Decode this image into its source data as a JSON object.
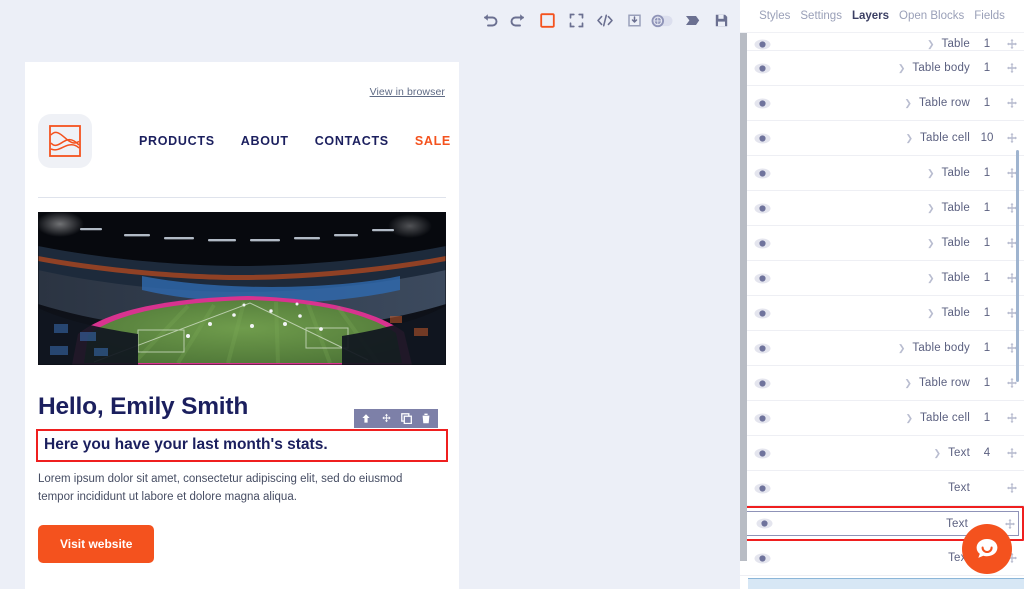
{
  "toolbar": {
    "buttons": [
      {
        "name": "undo-icon",
        "label": "Undo"
      },
      {
        "name": "redo-icon",
        "label": "Redo"
      },
      {
        "name": "border-toggle-icon",
        "label": "Toggle borders"
      },
      {
        "name": "fullscreen-icon",
        "label": "Fullscreen"
      },
      {
        "name": "code-icon",
        "label": "View code"
      },
      {
        "name": "import-icon",
        "label": "Import"
      },
      {
        "name": "preview-toggle-icon",
        "label": "Preview"
      },
      {
        "name": "send-icon",
        "label": "Send test"
      },
      {
        "name": "save-icon",
        "label": "Save"
      }
    ]
  },
  "email": {
    "view_in_browser": "View in browser",
    "logo_alt": "brand-logo",
    "nav": [
      {
        "label": "PRODUCTS",
        "sale": false
      },
      {
        "label": "ABOUT",
        "sale": false
      },
      {
        "label": "CONTACTS",
        "sale": false
      },
      {
        "label": "SALE",
        "sale": true
      }
    ],
    "hero_alt": "stadium-night-photo",
    "greeting": "Hello, Emily Smith",
    "subline": "Here you have your last month's stats.",
    "body": "Lorem ipsum dolor sit amet, consectetur adipiscing elit, sed do eiusmod tempor incididunt ut labore et dolore magna aliqua.",
    "cta_label": "Visit website",
    "element_toolbar": [
      {
        "name": "select-parent-icon",
        "label": "Select parent"
      },
      {
        "name": "move-icon",
        "label": "Move"
      },
      {
        "name": "copy-icon",
        "label": "Duplicate"
      },
      {
        "name": "trash-icon",
        "label": "Delete"
      }
    ]
  },
  "panel": {
    "tabs": [
      {
        "label": "Styles",
        "active": false
      },
      {
        "label": "Settings",
        "active": false
      },
      {
        "label": "Layers",
        "active": true
      },
      {
        "label": "Open Blocks",
        "active": false
      },
      {
        "label": "Fields",
        "active": false
      }
    ],
    "layers": [
      {
        "label": "Table",
        "count": "1",
        "indent": 3,
        "chevron": true,
        "clipped": true,
        "selected": false
      },
      {
        "label": "Table body",
        "count": "1",
        "indent": 3,
        "chevron": true,
        "clipped": false,
        "selected": false
      },
      {
        "label": "Table row",
        "count": "1",
        "indent": 4,
        "chevron": true,
        "clipped": false,
        "selected": false
      },
      {
        "label": "Table cell",
        "count": "10",
        "indent": 5,
        "chevron": true,
        "clipped": false,
        "selected": false
      },
      {
        "label": "Table",
        "count": "1",
        "indent": 6,
        "chevron": true,
        "clipped": false,
        "selected": false
      },
      {
        "label": "Table",
        "count": "1",
        "indent": 6,
        "chevron": true,
        "clipped": false,
        "selected": false
      },
      {
        "label": "Table",
        "count": "1",
        "indent": 6,
        "chevron": true,
        "clipped": false,
        "selected": false
      },
      {
        "label": "Table",
        "count": "1",
        "indent": 6,
        "chevron": true,
        "clipped": false,
        "selected": false
      },
      {
        "label": "Table",
        "count": "1",
        "indent": 6,
        "chevron": true,
        "clipped": false,
        "selected": false
      },
      {
        "label": "Table body",
        "count": "1",
        "indent": 6,
        "chevron": true,
        "clipped": false,
        "selected": false
      },
      {
        "label": "Table row",
        "count": "1",
        "indent": 7,
        "chevron": true,
        "clipped": false,
        "selected": false
      },
      {
        "label": "Table cell",
        "count": "1",
        "indent": 8,
        "chevron": true,
        "clipped": false,
        "selected": false
      },
      {
        "label": "Text",
        "count": "4",
        "indent": 9,
        "chevron": true,
        "clipped": false,
        "selected": false
      },
      {
        "label": "Text",
        "count": "",
        "indent": 9,
        "chevron": false,
        "clipped": false,
        "selected": false
      },
      {
        "label": "Text",
        "count": "",
        "indent": 9,
        "chevron": false,
        "clipped": false,
        "selected": true
      },
      {
        "label": "Text",
        "count": "",
        "indent": 9,
        "chevron": false,
        "clipped": false,
        "selected": false
      }
    ]
  },
  "chat": {
    "name": "chat-widget-icon",
    "label": "Chat"
  },
  "colors": {
    "accent_orange": "#f4521e",
    "navy": "#1b1f5e",
    "selection_red": "#ef1f1f",
    "panel_text": "#5b6080"
  }
}
